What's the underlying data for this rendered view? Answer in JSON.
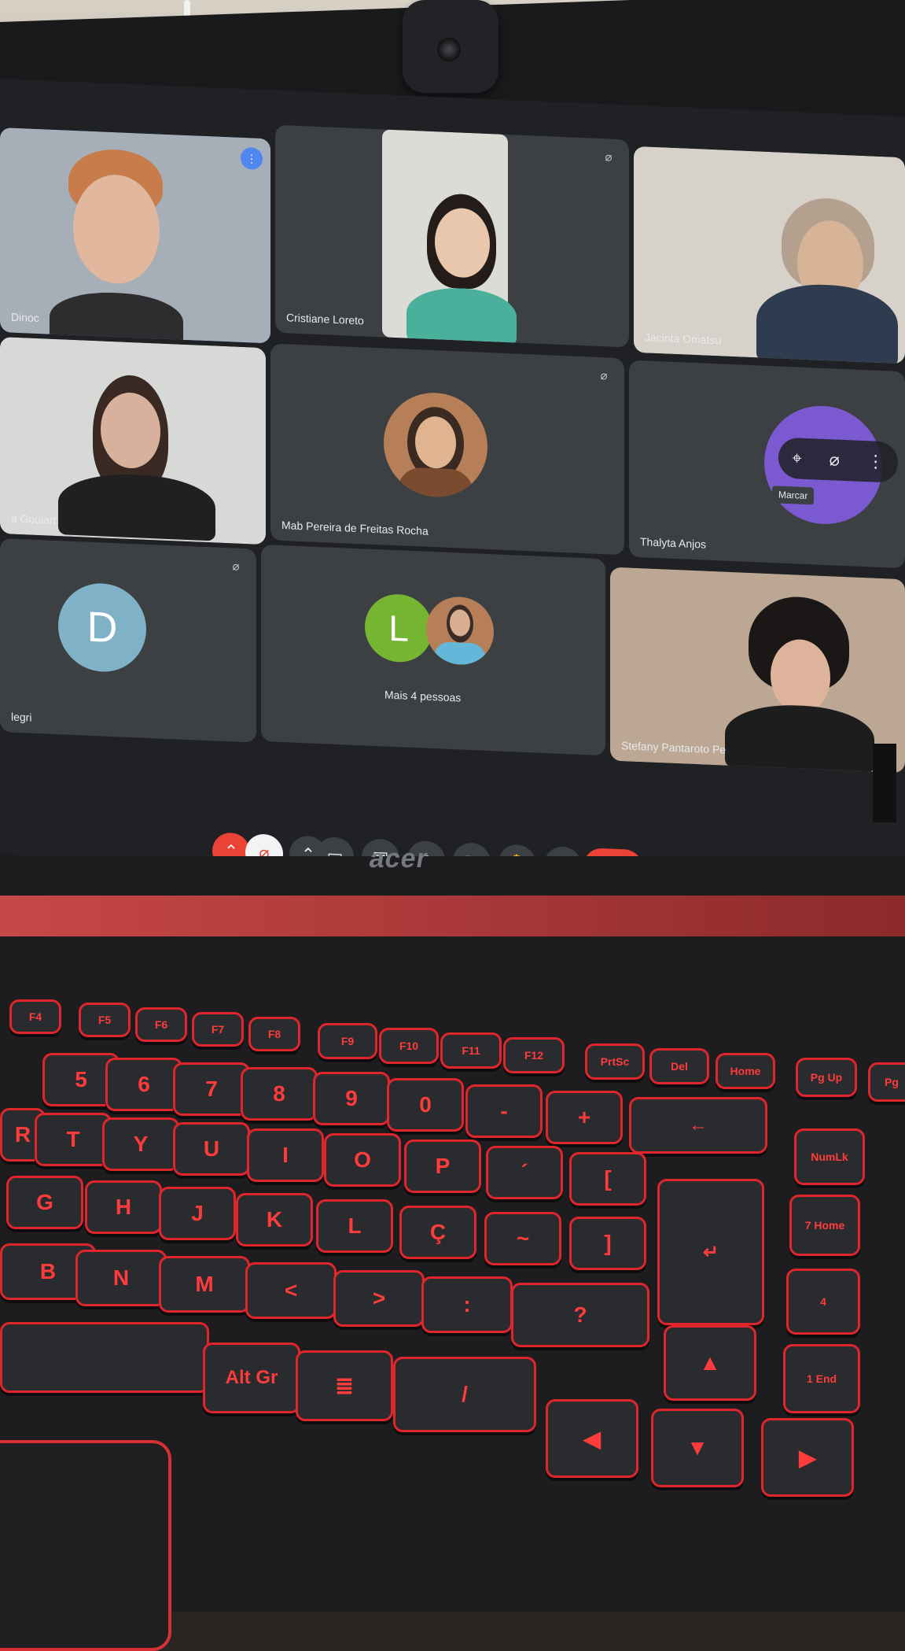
{
  "meeting": {
    "tiles": [
      {
        "name": "Dinoc",
        "state": "speaking"
      },
      {
        "name": "Cristiane Loreto"
      },
      {
        "name": "Jacinta Omatsu"
      },
      {
        "name": "a Goulart"
      },
      {
        "name": "Mab Pereira de Freitas Rocha"
      },
      {
        "name": "Thalyta Anjos"
      },
      {
        "name": "legri",
        "avatar_letter": "D"
      },
      {
        "name": "Mais 4 pessoas",
        "avatar_letter": "L"
      },
      {
        "name": "Stefany Pantaroto Pe"
      }
    ],
    "tooltip": "Marcar"
  },
  "laptop": {
    "brand": "acer"
  },
  "keyboard": {
    "function_row": [
      "F4",
      "F5",
      "F6",
      "F7",
      "F8",
      "F9",
      "F10",
      "F11",
      "F12",
      "PrtSc",
      "Del",
      "Home",
      "Pg Up",
      "Pg"
    ],
    "number_row": [
      "5",
      "6",
      "7",
      "8",
      "9",
      "0",
      "-",
      "+",
      "←"
    ],
    "top_row": [
      "R",
      "T",
      "Y",
      "U",
      "I",
      "O",
      "P",
      "´",
      "[",
      "[/]"
    ],
    "home_row": [
      "G",
      "H",
      "J",
      "K",
      "L",
      "Ç",
      "~",
      "]",
      "↵"
    ],
    "bottom_row": [
      "B",
      "N",
      "M",
      "<",
      ">",
      ":",
      "?",
      "Alt Gr",
      "≣",
      "/"
    ],
    "numpad": [
      "NumLk",
      "7 Home",
      "4",
      "1 End"
    ],
    "arrows": [
      "▲",
      "◀",
      "▼",
      "▶"
    ]
  }
}
